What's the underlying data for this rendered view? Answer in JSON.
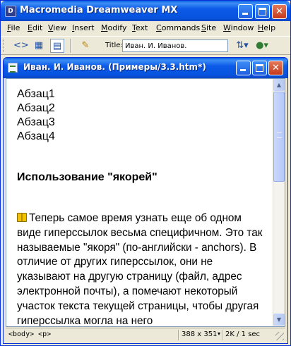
{
  "app": {
    "title": "Macromedia Dreamweaver MX",
    "icon_label": "D"
  },
  "menu": {
    "items": [
      "File",
      "Edit",
      "View",
      "Insert",
      "Modify",
      "Text",
      "Commands",
      "Site",
      "Window",
      "Help"
    ]
  },
  "toolbar": {
    "title_label": "Title:",
    "title_value": "Иван. И. Иванов."
  },
  "document": {
    "window_title": "Иван. И. Иванов. (Примеры/3.3.htm*)",
    "paragraphs": [
      "Абзац1",
      "Абзац2",
      "Абзац3",
      "Абзац4"
    ],
    "heading": "Использование \"якорей\"",
    "body_text": "Теперь самое время узнать еще об одном виде гиперссылок весьма специфичном. Это так называемые \"якоря\" (по-английски - anchors). В отличие от других гиперссылок, они не указывают на другую страницу (файл, адрес электронной почты), а помечают некоторый участок текста текущей страницы, чтобы другая гиперссылка могла на него"
  },
  "statusbar": {
    "tag_selector": "<body> <p>",
    "window_size": "388 x 351",
    "download_stats": "2K / 1 sec"
  },
  "colors": {
    "titlebar": "#0754E0",
    "chrome": "#ECE9D8",
    "close_button": "#C4391A"
  },
  "icons": [
    "code-view-icon",
    "split-view-icon",
    "design-view-icon",
    "live-data-icon",
    "file-management-icon",
    "preview-browser-icon",
    "book-icon"
  ]
}
